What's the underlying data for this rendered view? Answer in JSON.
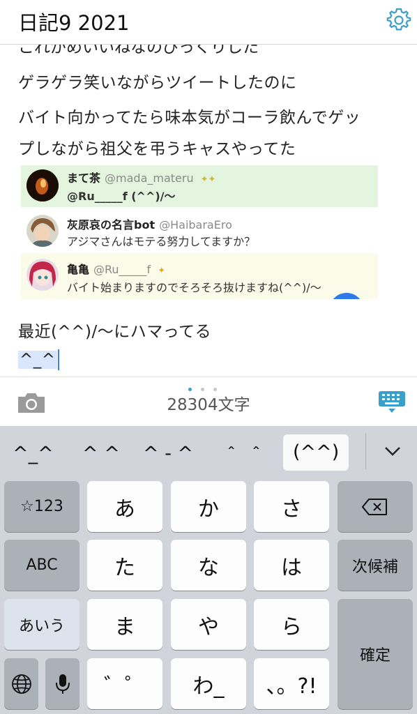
{
  "header": {
    "title": "日記9 2021",
    "settings_icon": "gear-icon"
  },
  "note": {
    "cut_line": "これがめいいねなのびっくりした",
    "lines": [
      "ゲラゲラ笑いながらツイートしたのに",
      "バイト向かってたら味本気がコーラ飲んでゲッ",
      "プしながら祖父を弔うキャスやってた",
      "最近(^^)/〜にハマってる"
    ],
    "typed_text": "^_^"
  },
  "tweets": [
    {
      "name": "まて茶",
      "handle": "@mada_materu",
      "badge": "✦✦",
      "text": "@Ru_____f (^^)/〜",
      "bg": "#e3f5df"
    },
    {
      "name": "灰原哀の名言bot",
      "handle": "@HaibaraEro",
      "badge": "",
      "text": "アジマさんはモテる努力してますか？",
      "bg": "#ffffff"
    },
    {
      "name": "亀亀",
      "handle": "@Ru_____f",
      "badge": "✦",
      "text": "バイト始まりますのでそろそろ抜けますね(^^)/〜",
      "bg": "#fbfbea"
    }
  ],
  "toolbar": {
    "char_count": "28304文字",
    "camera_icon": "camera-icon",
    "keyboard_icon": "keyboard-icon",
    "accent_color": "#3ba0c9"
  },
  "keyboard": {
    "candidates": [
      "^_^",
      "^ ^",
      "^ - ^",
      "＾ ＾",
      "(^^)"
    ],
    "selected_candidate": "(^^)",
    "rows": [
      [
        "☆123",
        "あ",
        "か",
        "さ",
        "⌫"
      ],
      [
        "ABC",
        "た",
        "な",
        "は",
        "次候補"
      ],
      [
        "あいう",
        "ま",
        "や",
        "ら",
        "確定"
      ],
      [
        "🌐",
        "🎤",
        "゛゜",
        "わ_",
        "、。?!"
      ]
    ],
    "labels": {
      "sym": "☆123",
      "abc": "ABC",
      "kana": "あいう",
      "next": "次候補",
      "confirm": "確定",
      "dakuten": "゛゜",
      "wa": "わ_",
      "punct": "、。?!"
    }
  }
}
